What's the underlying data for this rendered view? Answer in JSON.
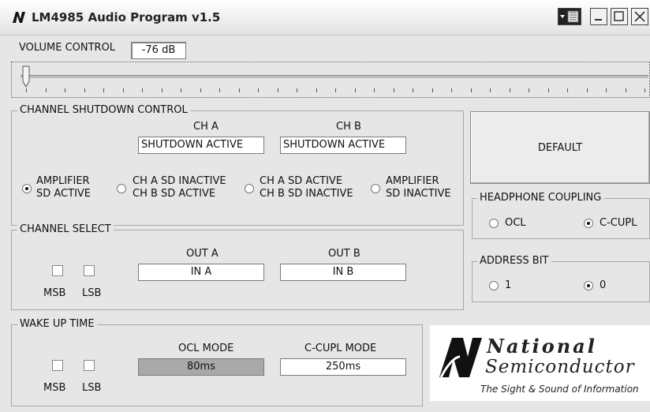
{
  "window": {
    "title": "LM4985 Audio Program v1.5"
  },
  "volume": {
    "label": "VOLUME CONTROL",
    "value": "-76 dB",
    "slider_level": 0.0
  },
  "channel_shutdown": {
    "label": "CHANNEL SHUTDOWN CONTROL",
    "ch_a_header": "CH A",
    "ch_b_header": "CH B",
    "ch_a_value": "SHUTDOWN ACTIVE",
    "ch_b_value": "SHUTDOWN ACTIVE",
    "options": [
      {
        "line1": "AMPLIFIER",
        "line2": "SD ACTIVE",
        "selected": true
      },
      {
        "line1": "CH A SD INACTIVE",
        "line2": "CH B SD ACTIVE",
        "selected": false
      },
      {
        "line1": "CH A SD ACTIVE",
        "line2": "CH B SD INACTIVE",
        "selected": false
      },
      {
        "line1": "AMPLIFIER",
        "line2": "SD INACTIVE",
        "selected": false
      }
    ]
  },
  "channel_select": {
    "label": "CHANNEL SELECT",
    "msb_label": "MSB",
    "lsb_label": "LSB",
    "out_a_header": "OUT A",
    "out_b_header": "OUT B",
    "out_a_value": "IN A",
    "out_b_value": "IN B"
  },
  "wake_up": {
    "label": "WAKE UP TIME",
    "msb_label": "MSB",
    "lsb_label": "LSB",
    "ocl_header": "OCL MODE",
    "ccupl_header": "C-CUPL MODE",
    "ocl_value": "80ms",
    "ccupl_value": "250ms"
  },
  "default_button": "DEFAULT",
  "headphone_coupling": {
    "label": "HEADPHONE COUPLING",
    "ocl": "OCL",
    "ccupl": "C-CUPL",
    "selected": "C-CUPL"
  },
  "address_bit": {
    "label": "ADDRESS BIT",
    "one": "1",
    "zero": "0",
    "selected": "0"
  },
  "logo": {
    "national": "National",
    "semiconductor": "Semiconductor",
    "tagline": "The Sight & Sound of Information"
  }
}
